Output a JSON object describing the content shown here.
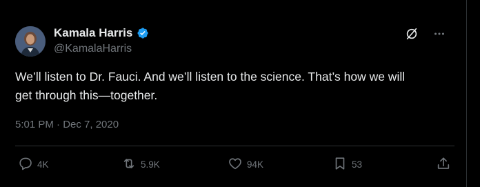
{
  "tweet": {
    "author_name": "Kamala Harris",
    "author_handle": "@KamalaHarris",
    "text_line1": "We’ll listen to Dr. Fauci. And we’ll listen to the science. That’s how we will",
    "text_line2": "get through this—together.",
    "timestamp": "5:01 PM · Dec 7, 2020"
  },
  "actions": {
    "reply_count": "4K",
    "retweet_count": "5.9K",
    "like_count": "94K",
    "bookmark_count": "53"
  },
  "icons": {
    "verified": "verified-badge-icon",
    "grok": "grok-icon",
    "more": "more-icon",
    "reply": "reply-icon",
    "retweet": "retweet-icon",
    "like": "heart-icon",
    "bookmark": "bookmark-icon",
    "share": "share-icon"
  },
  "colors": {
    "background": "#000000",
    "text_primary": "#e7e9ea",
    "text_secondary": "#71767b",
    "verified_blue": "#1d9bf0",
    "border": "#2f3336"
  }
}
